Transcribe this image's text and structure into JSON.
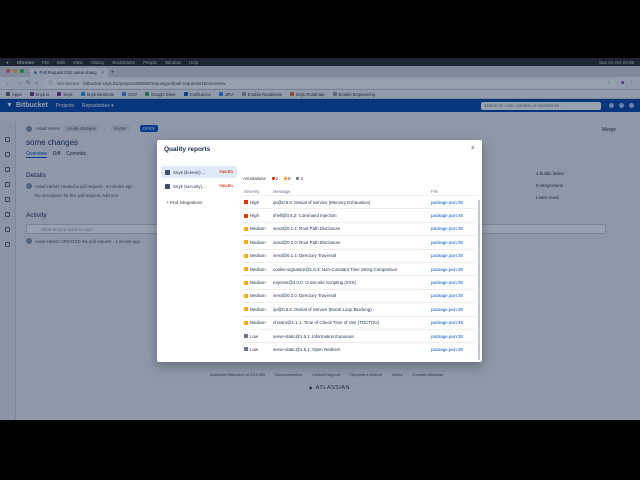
{
  "macos": {
    "apple": "",
    "app": "Chrome",
    "menus": [
      "File",
      "Edit",
      "View",
      "History",
      "Bookmarks",
      "People",
      "Window",
      "Help"
    ],
    "clock": "Sun 21 Oct  22:39"
  },
  "browser": {
    "tab_title": "Pull Request #18: some chang",
    "url_secure": "Not Secure",
    "url": "bitbucket.snyk.biz/projects/DEMO/repos/goof/pull-requests/18/overview",
    "bookmarks": [
      {
        "label": "Apps",
        "color": "#5f6368"
      },
      {
        "label": "Snyk.io",
        "color": "#7b2d8e"
      },
      {
        "label": "Snyk",
        "color": "#7b2d8e"
      },
      {
        "label": "Snyk Mentions",
        "color": "#1d9bf0"
      },
      {
        "label": "GCP",
        "color": "#4285f4"
      },
      {
        "label": "Google Drive",
        "color": "#34a853"
      },
      {
        "label": "Confluence",
        "color": "#0052cc"
      },
      {
        "label": "JIRA",
        "color": "#2684ff"
      },
      {
        "label": "Enable Readiness",
        "color": "#999999"
      },
      {
        "label": "Snyk Roadmap",
        "color": "#e06b2f"
      },
      {
        "label": "Enable Engineering",
        "color": "#999999"
      }
    ]
  },
  "bitbucket": {
    "logo": "Bitbucket",
    "nav": [
      "Projects",
      "Repositories ▾"
    ],
    "search_placeholder": "Search for code, commits or repositories..."
  },
  "pr": {
    "author": "Assaf Hefetz",
    "branch_from": "create-changes",
    "branch_to": "master",
    "state": "OPEN",
    "merge_label": "Merge",
    "title": "some changes",
    "tabs": [
      "Overview",
      "Diff",
      "Commits"
    ],
    "details_heading": "Details",
    "created_event": "Assaf Hefetz created a pull request · 4 minutes ago",
    "no_description": "No description for this pull request.  Add one",
    "activity_heading": "Activity",
    "comment_placeholder": "What do you want to say?",
    "activity_event": "Assaf Hefetz  UPDATED  the pull request  · 1 minute ago",
    "side_links": [
      "4 builds failed",
      "0 integrations",
      "Learn more"
    ]
  },
  "footer": {
    "links": [
      "Atlassian Bitbucket v5.15.0 MA",
      "Documentation",
      "Contact support",
      "Request a feature",
      "About",
      "Contact Atlassian"
    ],
    "brand": "▲ ATLASSIAN"
  },
  "modal": {
    "title": "Quality reports",
    "close": "×",
    "reports": [
      {
        "label": "Snyk (license) ...",
        "status": "FAILED",
        "selected": true
      },
      {
        "label": "Snyk (security)...",
        "status": "FAILED",
        "selected": false
      }
    ],
    "find_integrations": "Find integrations",
    "annotations_label": "Annotations",
    "annotation_counts": [
      {
        "count": "2",
        "color": "#de350b"
      },
      {
        "count": "8",
        "color": "#ff991f"
      },
      {
        "count": "2",
        "color": "#6b778c"
      }
    ],
    "columns": [
      "Severity",
      "Message",
      "File"
    ],
    "rows": [
      {
        "severity": "High",
        "color": "#de350b",
        "message": "qs@0.6.6: Denial of Service (Memory Exhaustion)",
        "file": "package.json:30"
      },
      {
        "severity": "High",
        "color": "#de350b",
        "message": "shell@0.6.2: Command Injection",
        "file": "package.json:48"
      },
      {
        "severity": "Medium",
        "color": "#ffab00",
        "message": "send@0.1.4: Root Path Disclosure",
        "file": "package.json:30"
      },
      {
        "severity": "Medium",
        "color": "#ffab00",
        "message": "send@0.2.0: Root Path Disclosure",
        "file": "package.json:30"
      },
      {
        "severity": "Medium",
        "color": "#ffab00",
        "message": "send@0.1.4: Directory Traversal",
        "file": "package.json:30"
      },
      {
        "severity": "Medium",
        "color": "#ffab00",
        "message": "cookie-signature@1.0.3: Non-Constant Time String Comparison",
        "file": "package.json:30"
      },
      {
        "severity": "Medium",
        "color": "#ffab00",
        "message": "express@4.0.0: Cross-site Scripting (XSS)",
        "file": "package.json:30"
      },
      {
        "severity": "Medium",
        "color": "#ffab00",
        "message": "send@0.2.0: Directory Traversal",
        "file": "package.json:30"
      },
      {
        "severity": "Medium",
        "color": "#ffab00",
        "message": "qs@0.6.6: Denial of Service (Event Loop Blocking)",
        "file": "package.json:30"
      },
      {
        "severity": "Medium",
        "color": "#ffab00",
        "message": "chownr@1.1.1: Time of Check Time of Use (TOCTOU)",
        "file": "package.json:45"
      },
      {
        "severity": "Low",
        "color": "#6b778c",
        "message": "serve-static@1.5.1: Information Exposure",
        "file": "package.json:30"
      },
      {
        "severity": "Low",
        "color": "#6b778c",
        "message": "serve-static@1.5.1: Open Redirect",
        "file": "package.json:30"
      }
    ]
  }
}
